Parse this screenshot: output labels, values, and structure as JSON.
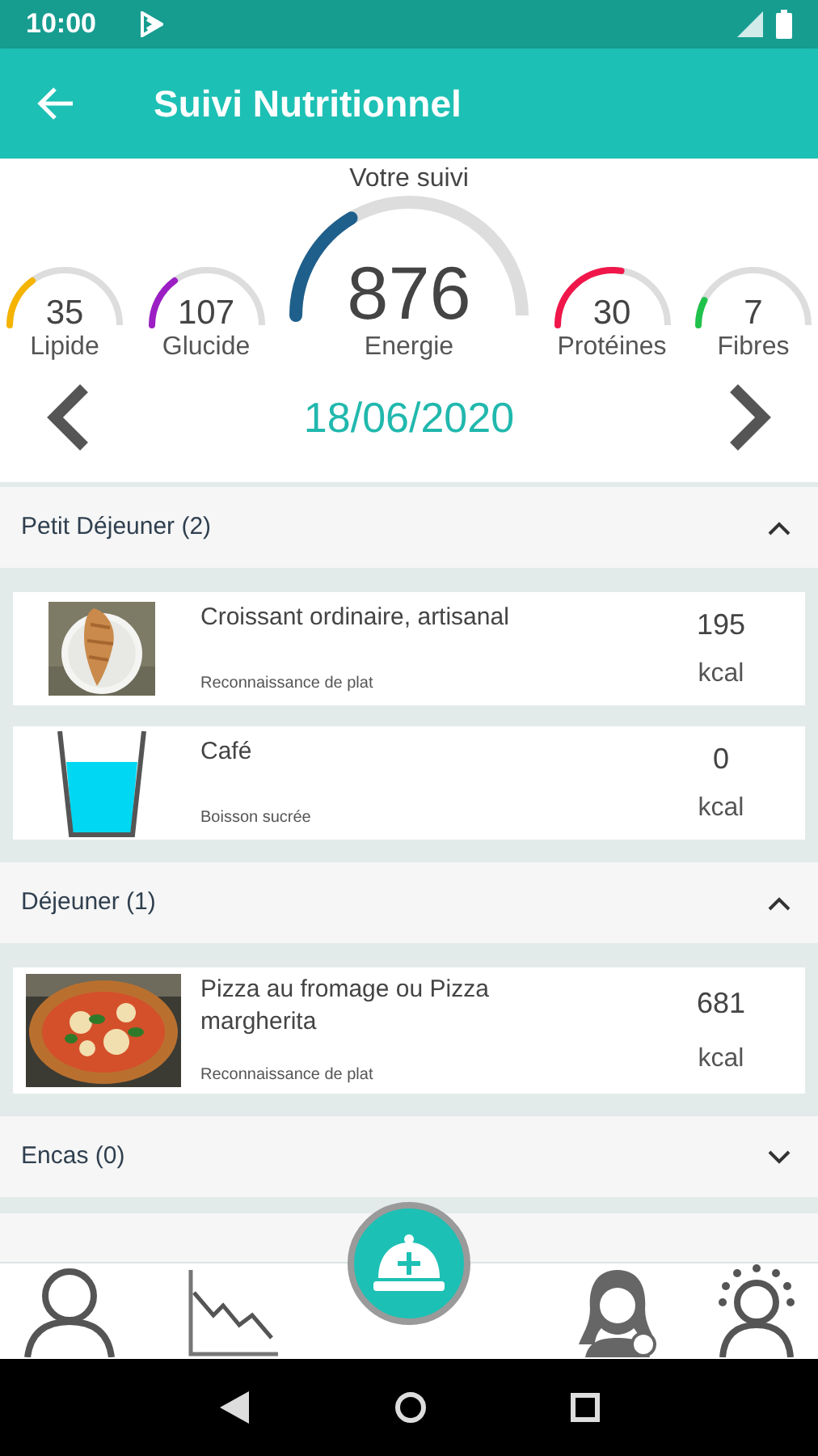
{
  "status_bar": {
    "time": "10:00"
  },
  "app_bar": {
    "title": "Suivi Nutritionnel"
  },
  "summary": {
    "title": "Votre suivi",
    "gauges": [
      {
        "kind": "small",
        "value": "35",
        "label": "Lipide",
        "color": "#f5b400"
      },
      {
        "kind": "small",
        "value": "107",
        "label": "Glucide",
        "color": "#9c1fc4"
      },
      {
        "kind": "large",
        "value": "876",
        "label": "Energie",
        "color": "#1f5f8b"
      },
      {
        "kind": "small",
        "value": "30",
        "label": "Protéines",
        "color": "#f0164a"
      },
      {
        "kind": "small",
        "value": "7",
        "label": "Fibres",
        "color": "#1fc24a"
      }
    ]
  },
  "date_nav": {
    "date": "18/06/2020"
  },
  "sections": [
    {
      "title": "Petit Déjeuner (2)",
      "expanded": true,
      "items": [
        {
          "kind": "croissant",
          "name": "Croissant ordinaire, artisanal",
          "source": "Reconnaissance de plat",
          "calories": "195",
          "unit": "kcal"
        },
        {
          "kind": "glass",
          "name": "Café",
          "source": "Boisson sucrée",
          "calories": "0",
          "unit": "kcal"
        }
      ]
    },
    {
      "title": "Déjeuner (1)",
      "expanded": true,
      "items": [
        {
          "kind": "pizza",
          "name": "Pizza au fromage ou Pizza margherita",
          "source": "Reconnaissance de plat",
          "calories": "681",
          "unit": "kcal"
        }
      ]
    },
    {
      "title": "Encas (0)",
      "expanded": false
    }
  ]
}
